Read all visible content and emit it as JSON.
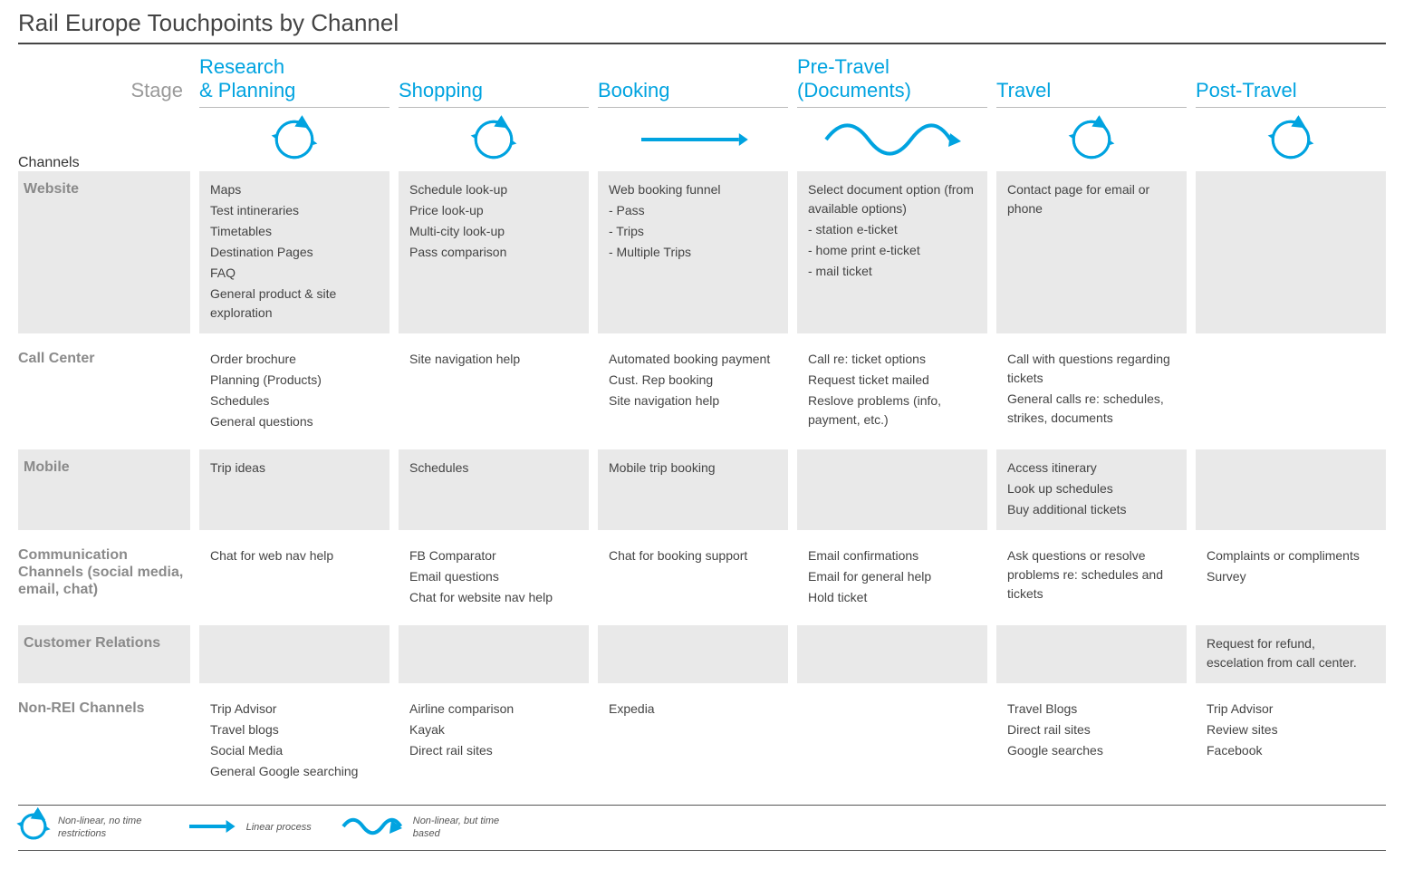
{
  "title": "Rail Europe Touchpoints by Channel",
  "stage_label": "Stage",
  "channels_label": "Channels",
  "stages": [
    {
      "name": "Research & Planning",
      "icon": "cycle"
    },
    {
      "name": "Shopping",
      "icon": "cycle"
    },
    {
      "name": "Booking",
      "icon": "arrow"
    },
    {
      "name": "Pre-Travel (Documents)",
      "icon": "wave"
    },
    {
      "name": "Travel",
      "icon": "cycle"
    },
    {
      "name": "Post-Travel",
      "icon": "cycle"
    }
  ],
  "channels": [
    {
      "name": "Website",
      "shaded": true,
      "cells": [
        [
          "Maps",
          "Test intineraries",
          "Timetables",
          "Destination Pages",
          "FAQ",
          "General product & site exploration"
        ],
        [
          "Schedule look-up",
          "Price look-up",
          "Multi-city look-up",
          "Pass comparison"
        ],
        [
          "Web booking funnel",
          "- Pass",
          "- Trips",
          "- Multiple Trips"
        ],
        [
          "Select document option (from available options)",
          "- station e-ticket",
          "- home print e-ticket",
          "- mail ticket"
        ],
        [
          "Contact page for email or phone"
        ],
        []
      ]
    },
    {
      "name": "Call Center",
      "shaded": false,
      "cells": [
        [
          "Order brochure",
          "Planning (Products)",
          "Schedules",
          "General questions"
        ],
        [
          "Site navigation help"
        ],
        [
          "Automated booking payment",
          "Cust. Rep booking",
          "Site navigation help"
        ],
        [
          "Call re: ticket options",
          "Request ticket mailed",
          "Reslove problems (info, payment, etc.)"
        ],
        [
          "Call with questions regarding tickets",
          "General calls re: schedules, strikes, documents"
        ],
        []
      ]
    },
    {
      "name": "Mobile",
      "shaded": true,
      "cells": [
        [
          "Trip ideas"
        ],
        [
          "Schedules"
        ],
        [
          "Mobile trip booking"
        ],
        [],
        [
          "Access itinerary",
          "Look up schedules",
          "Buy additional tickets"
        ],
        []
      ]
    },
    {
      "name": "Communication Channels (social media, email, chat)",
      "shaded": false,
      "cells": [
        [
          "Chat for web nav help"
        ],
        [
          "FB Comparator",
          "Email questions",
          "Chat for website nav help"
        ],
        [
          "Chat for booking support"
        ],
        [
          "Email confirmations",
          "Email for general help",
          "Hold ticket"
        ],
        [
          "Ask questions or resolve problems re: schedules and tickets"
        ],
        [
          "Complaints or compliments",
          "Survey"
        ]
      ]
    },
    {
      "name": "Customer Relations",
      "shaded": true,
      "cells": [
        [],
        [],
        [],
        [],
        [],
        [
          "Request for refund, escelation from call center."
        ]
      ]
    },
    {
      "name": "Non-REI Channels",
      "shaded": false,
      "cells": [
        [
          "Trip Advisor",
          "Travel blogs",
          "Social Media",
          "General Google searching"
        ],
        [
          "Airline comparison",
          "Kayak",
          "Direct rail sites"
        ],
        [
          "Expedia"
        ],
        [],
        [
          "Travel Blogs",
          "Direct rail sites",
          "Google searches"
        ],
        [
          "Trip Advisor",
          "Review sites",
          "Facebook"
        ]
      ]
    }
  ],
  "legend": [
    {
      "icon": "cycle",
      "text": "Non-linear, no time restrictions"
    },
    {
      "icon": "arrow",
      "text": "Linear process"
    },
    {
      "icon": "wave",
      "text": "Non-linear, but time based"
    }
  ]
}
